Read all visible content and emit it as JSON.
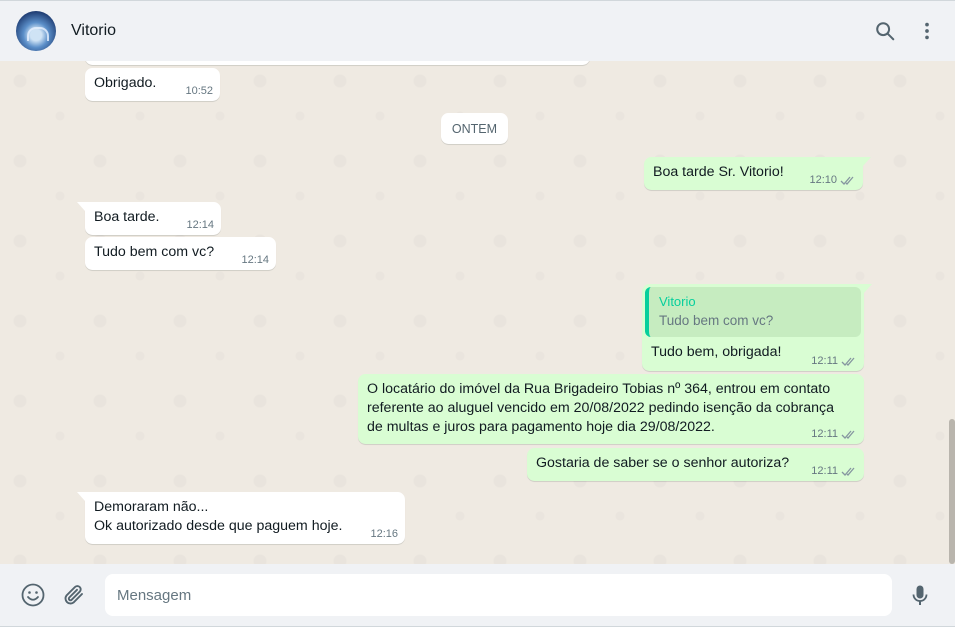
{
  "header": {
    "contact_name": "Vitorio",
    "search_icon": "search-icon",
    "menu_icon": "kebab-menu-icon"
  },
  "chat": {
    "date_separator": "ONTEM",
    "messages": [
      {
        "direction": "in",
        "text": "Obrigado.",
        "time": "10:52"
      },
      {
        "direction": "out",
        "text": "Boa tarde Sr. Vitorio!",
        "time": "12:10",
        "status": "read"
      },
      {
        "direction": "in",
        "text": "Boa tarde.",
        "time": "12:14"
      },
      {
        "direction": "in",
        "text": "Tudo bem com vc?",
        "time": "12:14"
      },
      {
        "direction": "out",
        "quote_author": "Vitorio",
        "quote_text": "Tudo bem com vc?",
        "text": "Tudo bem, obrigada!",
        "time": "12:11",
        "status": "read"
      },
      {
        "direction": "out",
        "text": "O locatário do imóvel da Rua Brigadeiro Tobias nº 364, entrou em contato\nreferente ao aluguel vencido  em 20/08/2022 pedindo isenção da cobrança\nde multas e juros para pagamento hoje dia 29/08/2022.",
        "time": "12:11",
        "status": "read"
      },
      {
        "direction": "out",
        "text": "Gostaria de saber se o senhor autoriza?",
        "time": "12:11",
        "status": "read"
      },
      {
        "direction": "in",
        "text": "Demoraram não...\nOk autorizado desde que paguem hoje.",
        "time": "12:16"
      }
    ]
  },
  "footer": {
    "placeholder": "Mensagem",
    "value": "",
    "emoji_icon": "emoji-icon",
    "attach_icon": "paperclip-icon",
    "mic_icon": "microphone-icon"
  },
  "colors": {
    "incoming_bubble": "#ffffff",
    "outgoing_bubble": "#d9fdd3",
    "chat_background": "#efeae2",
    "quote_accent": "#06cf9c"
  }
}
